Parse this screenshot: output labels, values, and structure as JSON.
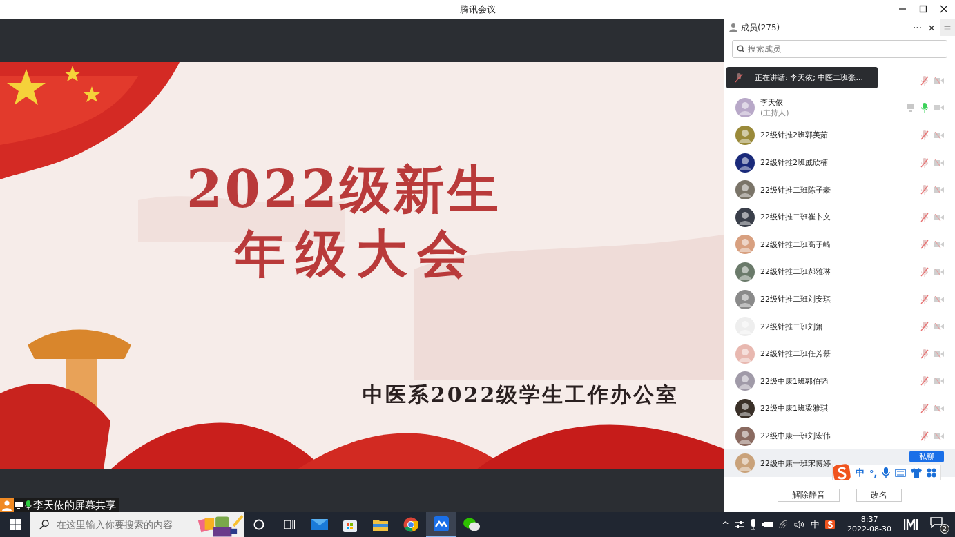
{
  "window": {
    "title": "腾讯会议"
  },
  "slide": {
    "title_line_1": "2022级新生",
    "title_line_2": "年级大会",
    "subtitle": "中医系2022级学生工作办公室"
  },
  "share_label": {
    "text": "李天依的屏幕共享"
  },
  "members_panel": {
    "title": "成员(275)",
    "more": "···",
    "close": "×",
    "menu": "≡",
    "search": {
      "placeholder": "搜索成员"
    },
    "speaking_banner": "正在讲话: 李天依; 中医二班张...",
    "members": [
      {
        "mic_on": false,
        "sharing": false,
        "selected": false
      },
      {
        "name": "李天依",
        "sub": "(主持人)",
        "mic_on": true,
        "sharing": true,
        "selected": false
      },
      {
        "name": "22级针推2班郭美茹",
        "mic_on": false,
        "sharing": false,
        "selected": false
      },
      {
        "name": "22级针推2班戚欣楠",
        "mic_on": false,
        "sharing": false,
        "selected": false
      },
      {
        "name": "22级针推二班陈子豪",
        "mic_on": false,
        "sharing": false,
        "selected": false
      },
      {
        "name": "22级针推二班崔卜文",
        "mic_on": false,
        "sharing": false,
        "selected": false
      },
      {
        "name": "22级针推二班高子崎",
        "mic_on": false,
        "sharing": false,
        "selected": false
      },
      {
        "name": "22级针推二班郝雅琳",
        "mic_on": false,
        "sharing": false,
        "selected": false
      },
      {
        "name": "22级针推二班刘安琪",
        "mic_on": false,
        "sharing": false,
        "selected": false
      },
      {
        "name": "22级针推二班刘箫",
        "mic_on": false,
        "sharing": false,
        "selected": false
      },
      {
        "name": "22级针推二班任芳慕",
        "mic_on": false,
        "sharing": false,
        "selected": false
      },
      {
        "name": "22级中康1班郭伯韬",
        "mic_on": false,
        "sharing": false,
        "selected": false
      },
      {
        "name": "22级中康1班梁雅琪",
        "mic_on": false,
        "sharing": false,
        "selected": false
      },
      {
        "name": "22级中康一班刘宏伟",
        "mic_on": false,
        "sharing": false,
        "selected": false
      },
      {
        "name": "22级中康一班宋博婷",
        "selected": true,
        "action": "私聊"
      }
    ],
    "buttons": [
      "解除静音",
      "改名"
    ]
  },
  "ime_toolbar": {
    "mode": "中",
    "punct": "°,"
  },
  "taskbar": {
    "search": {
      "placeholder": "在这里输入你要搜索的内容"
    },
    "apps": [
      {
        "kind": "cortana",
        "selected": false
      },
      {
        "kind": "taskview",
        "selected": false
      },
      {
        "kind": "mail",
        "selected": false
      },
      {
        "kind": "store",
        "selected": false
      },
      {
        "kind": "explorer",
        "selected": false
      },
      {
        "kind": "chrome",
        "selected": false
      },
      {
        "kind": "meeting",
        "selected": true
      },
      {
        "kind": "wechat",
        "selected": false
      }
    ],
    "tray": {
      "chevron": "^",
      "ime": "中",
      "time": "8:37",
      "date": "2022-08-30",
      "notifications": "2"
    }
  }
}
